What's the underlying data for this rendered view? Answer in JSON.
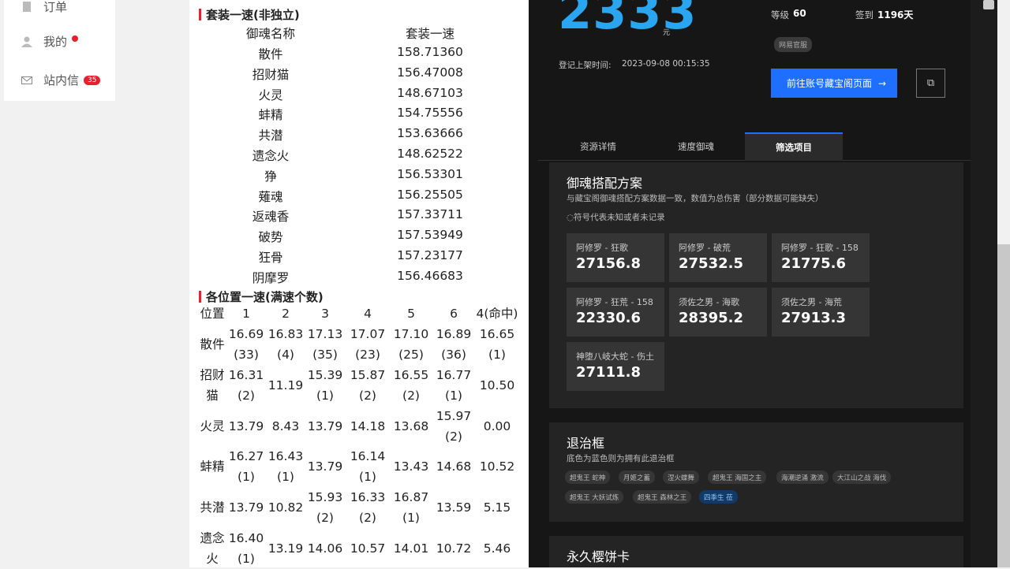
{
  "sidebar": {
    "items": [
      {
        "label": "订单"
      },
      {
        "label": "我的"
      },
      {
        "label": "站内信",
        "badge": "35"
      }
    ]
  },
  "doc": {
    "section1_title": "套装一速(非独立)",
    "table1": {
      "headers": [
        "御魂名称",
        "套装一速"
      ],
      "rows": [
        [
          "散件",
          "158.71360"
        ],
        [
          "招财猫",
          "156.47008"
        ],
        [
          "火灵",
          "148.67103"
        ],
        [
          "蚌精",
          "154.75556"
        ],
        [
          "共潜",
          "153.63666"
        ],
        [
          "遗念火",
          "148.62522"
        ],
        [
          "狰",
          "156.53301"
        ],
        [
          "薙魂",
          "156.25505"
        ],
        [
          "返魂香",
          "157.33711"
        ],
        [
          "破势",
          "157.53949"
        ],
        [
          "狂骨",
          "157.23177"
        ],
        [
          "阴摩罗",
          "156.46683"
        ]
      ]
    },
    "section2_title": "各位置一速(满速个数)",
    "table2": {
      "headers": [
        "位置",
        "1",
        "2",
        "3",
        "4",
        "5",
        "6",
        "4(命中)"
      ],
      "rows": [
        {
          "name": [
            "散件"
          ],
          "cells": [
            [
              "16.69",
              "(33)"
            ],
            [
              "16.83",
              "(4)"
            ],
            [
              "17.13",
              "(35)"
            ],
            [
              "17.07",
              "(23)"
            ],
            [
              "17.10",
              "(25)"
            ],
            [
              "16.89",
              "(36)"
            ],
            [
              "16.65",
              "(1)"
            ]
          ]
        },
        {
          "name": [
            "招财",
            "猫"
          ],
          "cells": [
            [
              "16.31",
              "(2)"
            ],
            [
              "11.19"
            ],
            [
              "15.39",
              "(1)"
            ],
            [
              "15.87",
              "(2)"
            ],
            [
              "16.55",
              "(2)"
            ],
            [
              "16.77",
              "(1)"
            ],
            [
              "10.50"
            ]
          ]
        },
        {
          "name": [
            "火灵"
          ],
          "cells": [
            [
              "13.79"
            ],
            [
              "8.43"
            ],
            [
              "13.79"
            ],
            [
              "14.18"
            ],
            [
              "13.68"
            ],
            [
              "15.97",
              "(2)"
            ],
            [
              "0.00"
            ]
          ]
        },
        {
          "name": [
            "蚌精"
          ],
          "cells": [
            [
              "16.27",
              "(1)"
            ],
            [
              "16.43",
              "(1)"
            ],
            [
              "13.79"
            ],
            [
              "16.14",
              "(1)"
            ],
            [
              "13.43"
            ],
            [
              "14.68"
            ],
            [
              "10.52"
            ]
          ]
        },
        {
          "name": [
            "共潜"
          ],
          "cells": [
            [
              "13.79"
            ],
            [
              "10.82"
            ],
            [
              "15.93",
              "(2)"
            ],
            [
              "16.33",
              "(2)"
            ],
            [
              "16.87",
              "(1)"
            ],
            [
              "13.59"
            ],
            [
              "5.15"
            ]
          ]
        },
        {
          "name": [
            "遗念",
            "火"
          ],
          "cells": [
            [
              "16.40",
              "(1)"
            ],
            [
              "13.19"
            ],
            [
              "14.06"
            ],
            [
              "10.57"
            ],
            [
              "14.01"
            ],
            [
              "10.72"
            ],
            [
              "5.46"
            ]
          ]
        }
      ]
    }
  },
  "account": {
    "price": "2333",
    "price_unit": "元",
    "level_label": "等级",
    "level_value": "60",
    "signin_label": "签到",
    "signin_value": "1196天",
    "server_tag": "网易官服",
    "listed_label": "登记上架时间:",
    "listed_time": "2023-09-08 00:15:35",
    "goto_button": "前往账号藏宝阁页面",
    "goto_arrow": "→",
    "copy_icon": "⧉"
  },
  "tabs": [
    {
      "label": "资源详情"
    },
    {
      "label": "速度御魂"
    },
    {
      "label": "筛选项目"
    }
  ],
  "yuhun_panel": {
    "title": "御魂搭配方案",
    "desc": "与藏宝阁御魂搭配方案数据一致，数值为总伤害（部分数据可能缺失）",
    "note": "◌符号代表未知或者未记录",
    "cards": [
      {
        "name": "阿修罗 - 狂歌",
        "value": "27156.8"
      },
      {
        "name": "阿修罗 - 破荒",
        "value": "27532.5"
      },
      {
        "name": "阿修罗 - 狂歌 - 158",
        "value": "21775.6"
      },
      {
        "name": "阿修罗 - 狂荒 - 158",
        "value": "22330.6"
      },
      {
        "name": "须佐之男 - 海歌",
        "value": "28395.2"
      },
      {
        "name": "须佐之男 - 海荒",
        "value": "27913.3"
      },
      {
        "name": "神堕八岐大蛇 - 伤土",
        "value": "27111.8"
      }
    ]
  },
  "frame_panel": {
    "title": "退治框",
    "desc": "底色为蓝色则为拥有此退治框",
    "chips": [
      {
        "label": "超鬼王 蛇神",
        "owned": false
      },
      {
        "label": "月姬之蓄",
        "owned": false
      },
      {
        "label": "涅火蝶舞",
        "owned": false
      },
      {
        "label": "超鬼王 海国之主",
        "owned": false
      },
      {
        "label": "海潮逆涌 激流",
        "owned": false
      },
      {
        "label": "大江山之战 海伐",
        "owned": false
      },
      {
        "label": "超鬼王 大妖试炼",
        "owned": false
      },
      {
        "label": "超鬼王 森林之王",
        "owned": false
      },
      {
        "label": "四季生 莅",
        "owned": true
      }
    ]
  },
  "card_panel": {
    "title": "永久樱饼卡"
  }
}
